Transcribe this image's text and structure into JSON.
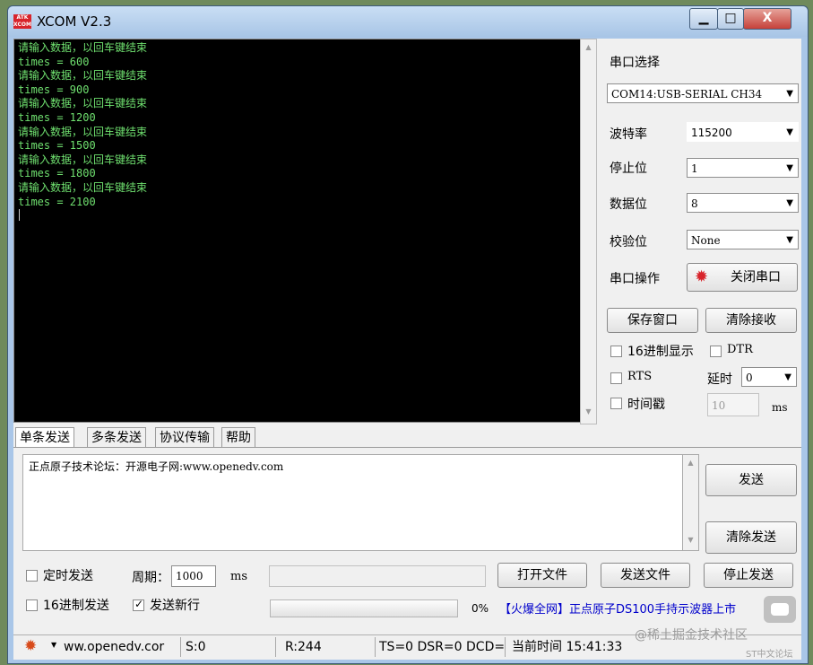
{
  "window": {
    "logo": "ATK\nXCOM",
    "title": "XCOM V2.3",
    "minimize": "▁",
    "maximize": "□",
    "close": "X"
  },
  "terminal": {
    "lines": "请输入数据，以回车键结束\ntimes = 600\n请输入数据，以回车键结束\ntimes = 900\n请输入数据，以回车键结束\ntimes = 1200\n请输入数据，以回车键结束\ntimes = 1500\n请输入数据，以回车键结束\ntimes = 1800\n请输入数据，以回车键结束\ntimes = 2100"
  },
  "settings": {
    "port_label": "串口选择",
    "port_value": "COM14:USB-SERIAL CH34",
    "baud_label": "波特率",
    "baud_value": "115200",
    "stop_label": "停止位",
    "stop_value": "1",
    "data_label": "数据位",
    "data_value": "8",
    "parity_label": "校验位",
    "parity_value": "None",
    "op_label": "串口操作",
    "op_button": "关闭串口",
    "save_window": "保存窗口",
    "clear_receive": "清除接收",
    "hex_display": "16进制显示",
    "dtr": "DTR",
    "rts": "RTS",
    "delay_label": "延时",
    "delay_value": "0",
    "timestamp": "时间戳",
    "timestamp_value": "10",
    "timestamp_unit": "ms"
  },
  "tabs": [
    "单条发送",
    "多条发送",
    "协议传输",
    "帮助"
  ],
  "send": {
    "text": "正点原子技术论坛：开源电子网:www.openedv.com",
    "send_button": "发送",
    "clear_send": "清除发送",
    "timed_send": "定时发送",
    "period_label": "周期：",
    "period_value": "1000",
    "period_unit": "ms",
    "open_file": "打开文件",
    "send_file": "发送文件",
    "stop_send": "停止发送",
    "hex_send": "16进制发送",
    "send_newline": "发送新行",
    "progress_text": "0%",
    "progress": 0,
    "ad_text": "【火爆全网】正点原子DS100手持示波器上市"
  },
  "statusbar": {
    "url": "ww.openedv.cor",
    "sent": "S:0",
    "received": "R:244",
    "signals": "TS=0 DSR=0 DCD=",
    "time": "当前时间 15:41:33",
    "watermark": "@稀土掘金技术社区",
    "badge": "ST中文论坛"
  },
  "colors": {
    "terminal_text": "#6fe06f",
    "terminal_bg": "#000000",
    "ad_text": "#0000cc"
  }
}
